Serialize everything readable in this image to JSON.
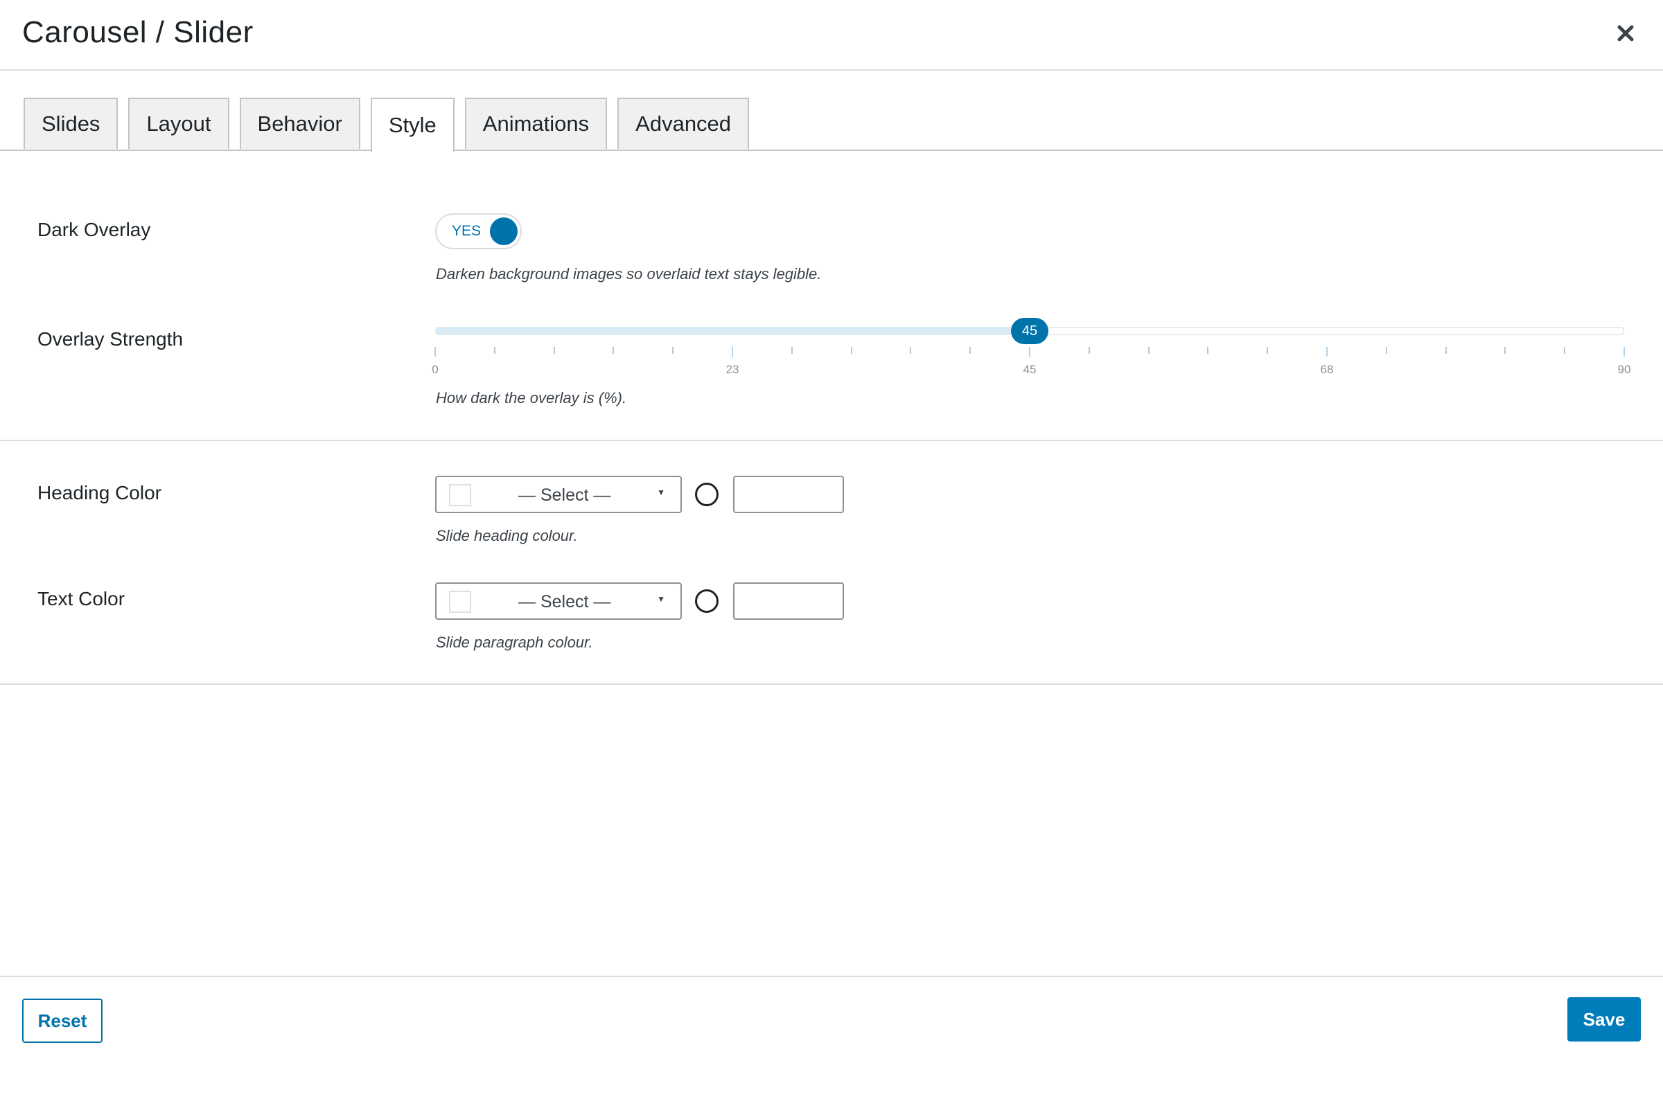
{
  "dialog": {
    "title": "Carousel / Slider",
    "close_icon": "close-icon"
  },
  "tabs": [
    {
      "label": "Slides",
      "active": false
    },
    {
      "label": "Layout",
      "active": false
    },
    {
      "label": "Behavior",
      "active": false
    },
    {
      "label": "Style",
      "active": true
    },
    {
      "label": "Animations",
      "active": false
    },
    {
      "label": "Advanced",
      "active": false
    }
  ],
  "dark_overlay": {
    "label": "Dark Overlay",
    "toggle_text": "YES",
    "enabled": true,
    "description": "Darken background images so overlaid text stays legible."
  },
  "overlay_strength": {
    "label": "Overlay Strength",
    "value": "45",
    "min": 0,
    "max": 90,
    "tick_labels": [
      "0",
      "23",
      "45",
      "68",
      "90"
    ],
    "description": "How dark the overlay is (%)."
  },
  "heading_color": {
    "label": "Heading Color",
    "select_text": "— Select —",
    "hex_value": "",
    "description": "Slide heading colour."
  },
  "text_color": {
    "label": "Text Color",
    "select_text": "— Select —",
    "hex_value": "",
    "description": "Slide paragraph colour."
  },
  "footer": {
    "reset_label": "Reset",
    "save_label": "Save"
  },
  "colors": {
    "accent": "#0073aa",
    "primary_button": "#007cba"
  }
}
